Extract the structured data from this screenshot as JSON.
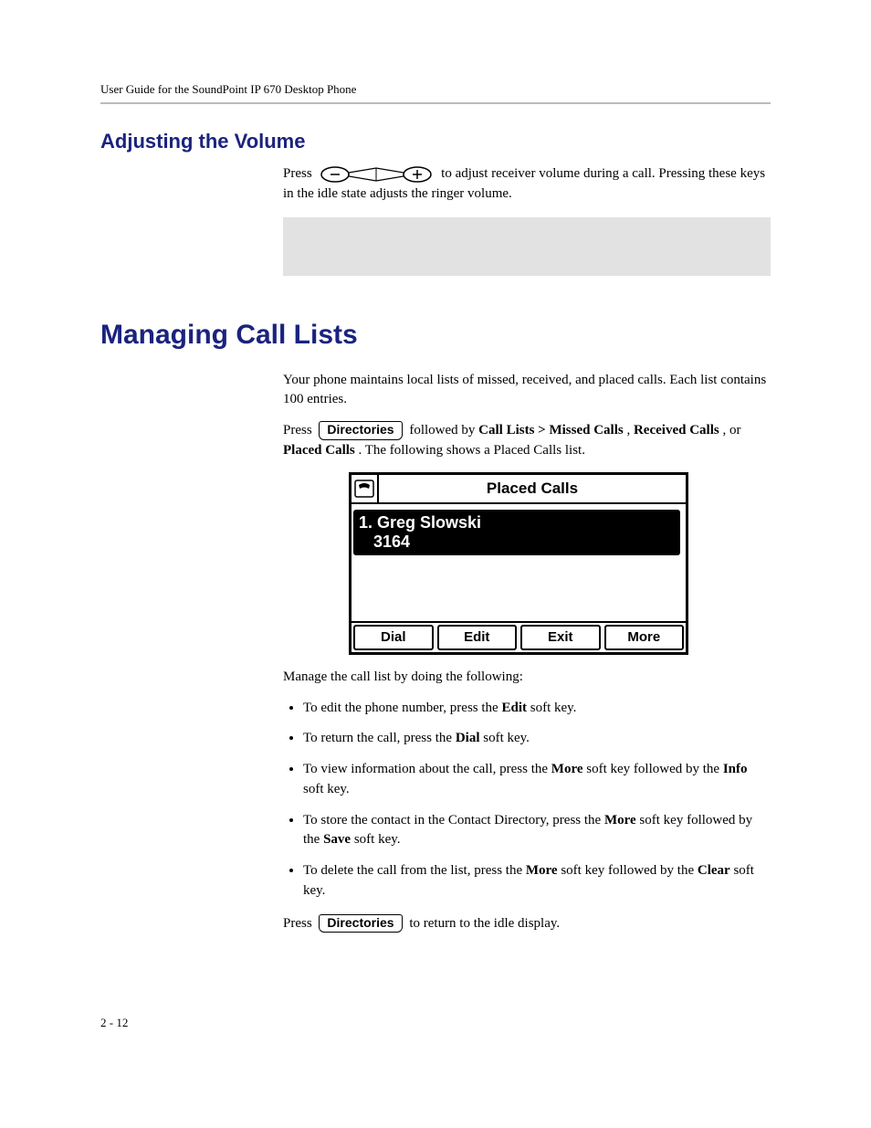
{
  "header": {
    "running_head": "User Guide for the SoundPoint IP 670 Desktop Phone"
  },
  "section1": {
    "heading": "Adjusting the Volume",
    "p1a": "Press ",
    "p1b": " to adjust receiver volume during a call. Pressing these keys in the idle state adjusts the ringer volume."
  },
  "section2": {
    "heading": "Managing Call Lists",
    "intro": "Your phone maintains local lists of missed, received, and placed calls. Each list contains 100 entries.",
    "p2a": "Press ",
    "dir_label": "Directories",
    "p2b": " followed by ",
    "p2c": "Call Lists > Missed Calls",
    "p2d": ", ",
    "p2e": "Received Calls",
    "p2f": ", or ",
    "p2g": "Placed Calls",
    "p2h": ". The following shows a Placed Calls list.",
    "manage_intro": "Manage the call list by doing the following:",
    "b1a": "To edit the phone number, press the ",
    "b1b": "Edit",
    "b1c": " soft key.",
    "b2a": "To return the call, press the ",
    "b2b": "Dial",
    "b2c": " soft key.",
    "b3a": "To view information about the call, press the ",
    "b3b": "More",
    "b3c": " soft key followed by the ",
    "b3d": "Info",
    "b3e": " soft key.",
    "b4a": "To store the contact in the Contact Directory, press the ",
    "b4b": "More",
    "b4c": " soft key followed by the ",
    "b4d": "Save",
    "b4e": " soft key.",
    "b5a": "To delete the call from the list, press the ",
    "b5b": "More",
    "b5c": " soft key followed by the ",
    "b5d": "Clear",
    "b5e": " soft key.",
    "p3a": "Press ",
    "p3b": " to return to the idle display."
  },
  "screen": {
    "title": "Placed Calls",
    "entry_line1": "1. Greg Slowski",
    "entry_line2": "3164",
    "softkeys": [
      "Dial",
      "Edit",
      "Exit",
      "More"
    ]
  },
  "footer": {
    "page_number": "2 - 12"
  }
}
